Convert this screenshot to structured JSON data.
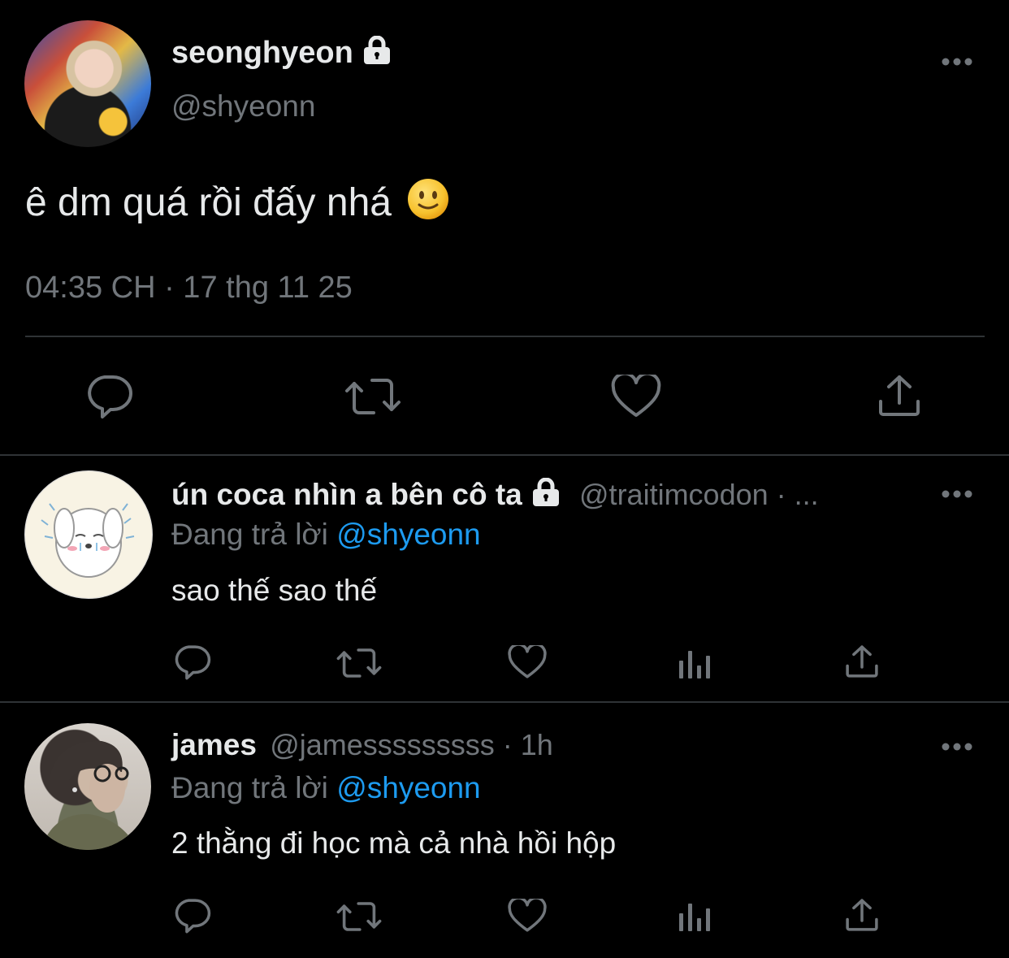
{
  "main_tweet": {
    "display_name": "seonghyeon",
    "handle": "@shyeonn",
    "text": "ê dm quá rồi đấy nhá",
    "emoji": "slightly-smiling-face",
    "timestamp": "04:35 CH · 17 thg 11 25",
    "actions": [
      "reply-icon",
      "retweet-icon",
      "like-icon",
      "share-icon"
    ]
  },
  "replies": [
    {
      "display_name": "ún coca nhìn a bên cô ta",
      "handle": "@traitimcodon · ...",
      "replying_prefix": "Đang trả lời",
      "replying_to": "@shyeonn",
      "text": "sao thế sao thế",
      "locked": true
    },
    {
      "display_name": "james",
      "handle": "@jamesssssssss · 1h",
      "replying_prefix": "Đang trả lời",
      "replying_to": "@shyeonn",
      "text": "2 thằng đi học mà cả nhà hồi hộp",
      "locked": false
    }
  ],
  "colors": {
    "background": "#000000",
    "text": "#e7e9ea",
    "muted": "#71767b",
    "accent": "#1d9bf0",
    "divider": "#2f3336"
  }
}
